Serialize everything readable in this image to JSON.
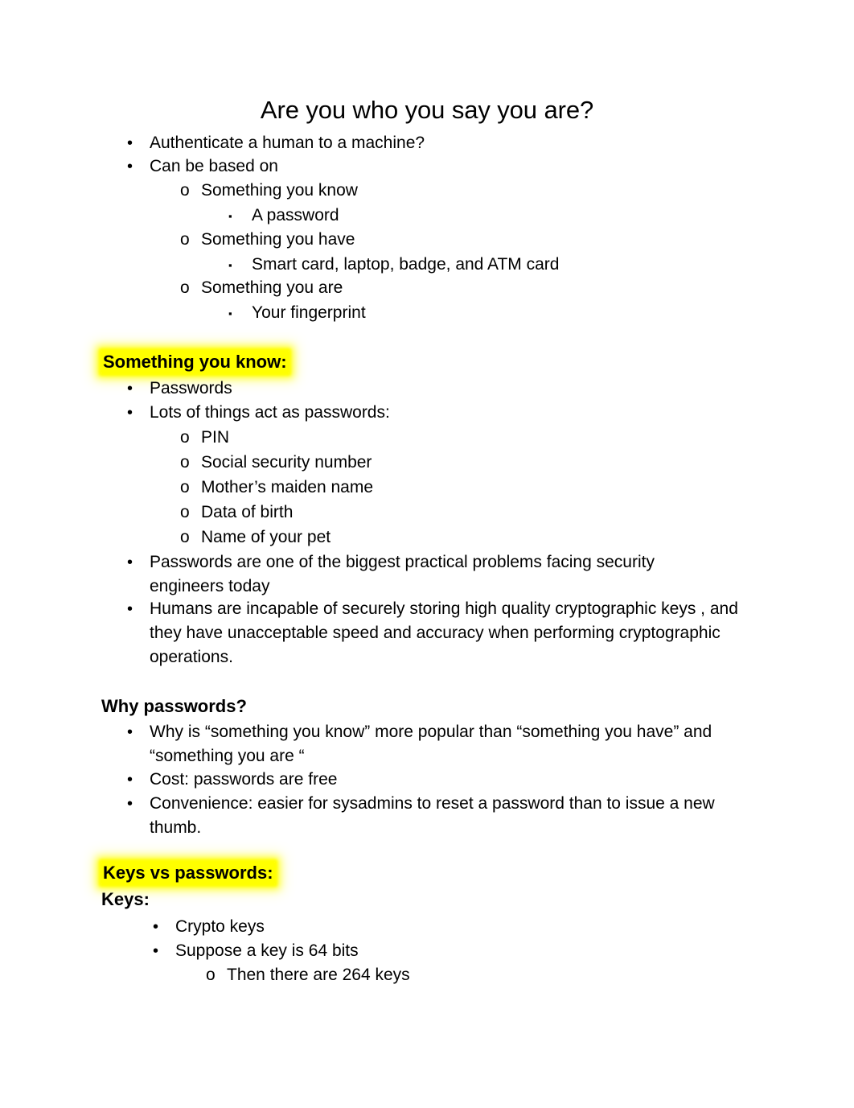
{
  "document": {
    "title": "Are you who you say you are?",
    "highlight_color": "#ffff00",
    "text_color": "#000000",
    "background_color": "#ffffff"
  },
  "markers": {
    "disc": "•",
    "circle": "o",
    "square": "▪"
  },
  "intro": {
    "items": [
      {
        "level": 1,
        "text": "Authenticate a human to a machine?"
      },
      {
        "level": 1,
        "text": "Can be based on"
      },
      {
        "level": 2,
        "text": "Something you know"
      },
      {
        "level": 3,
        "text": "A password"
      },
      {
        "level": 2,
        "text": "Something you have"
      },
      {
        "level": 3,
        "text": "Smart card, laptop, badge, and ATM card"
      },
      {
        "level": 2,
        "text": "Something you are"
      },
      {
        "level": 3,
        "text": "Your fingerprint"
      }
    ]
  },
  "section_something_you_know": {
    "heading": "Something you know:",
    "highlighted": true,
    "items": [
      {
        "level": 1,
        "text": "Passwords"
      },
      {
        "level": 1,
        "text": "Lots of things act as passwords:"
      },
      {
        "level": 2,
        "text": "PIN"
      },
      {
        "level": 2,
        "text": "Social security number"
      },
      {
        "level": 2,
        "text": "Mother’s maiden name"
      },
      {
        "level": 2,
        "text": "Data of birth"
      },
      {
        "level": 2,
        "text": "Name of your pet"
      },
      {
        "level": 1,
        "text": "Passwords are one of the biggest practical problems facing security engineers today"
      },
      {
        "level": 1,
        "text": "Humans are incapable of securely storing high quality cryptographic keys , and they have unacceptable speed and accuracy when performing cryptographic operations."
      }
    ]
  },
  "section_why_passwords": {
    "heading": "Why passwords?",
    "highlighted": false,
    "items": [
      {
        "level": 1,
        "text": "Why is “something you know” more popular than “something you have” and “something you are “"
      },
      {
        "level": 1,
        "text": "Cost: passwords are free"
      },
      {
        "level": 1,
        "text": "Convenience: easier for sysadmins to reset a password than to issue a new thumb."
      }
    ]
  },
  "section_keys_vs_passwords": {
    "heading": "Keys vs passwords:",
    "highlighted": true,
    "subheading": "Keys:",
    "subheading_highlighted": false,
    "items": [
      {
        "level": 1,
        "text": "Crypto keys"
      },
      {
        "level": 1,
        "text": "Suppose a key is 64 bits"
      },
      {
        "level": 2,
        "text": "Then there are 264 keys"
      }
    ]
  }
}
